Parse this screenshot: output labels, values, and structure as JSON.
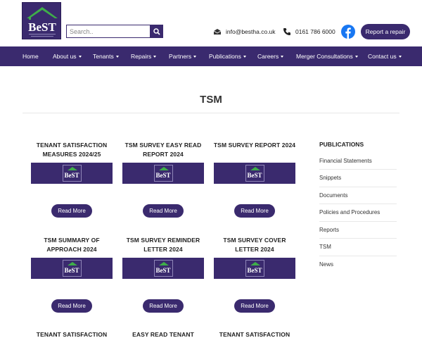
{
  "header": {
    "logo_text": "BeST",
    "search_placeholder": "Search..",
    "email": "info@bestha.co.uk",
    "phone": "0161 786 6000",
    "repair_label": "Report a repair"
  },
  "nav": [
    {
      "label": "Home",
      "dropdown": false
    },
    {
      "label": "About us",
      "dropdown": true
    },
    {
      "label": "Tenants",
      "dropdown": true
    },
    {
      "label": "Repairs",
      "dropdown": true
    },
    {
      "label": "Partners",
      "dropdown": true
    },
    {
      "label": "Publications",
      "dropdown": true
    },
    {
      "label": "Careers",
      "dropdown": true
    },
    {
      "label": "Merger Consultations",
      "dropdown": true
    },
    {
      "label": "Contact us",
      "dropdown": true
    }
  ],
  "page": {
    "title": "TSM"
  },
  "cards": [
    {
      "title": "TENANT SATISFACTION MEASURES 2024/25",
      "logo": "BeST",
      "button": "Read More"
    },
    {
      "title": "TSM SURVEY EASY READ REPORT 2024",
      "logo": "BeST",
      "button": "Read More"
    },
    {
      "title": "TSM SURVEY REPORT 2024",
      "logo": "BeST",
      "button": "Read More"
    },
    {
      "title": "TSM SUMMARY OF APPROACH 2024",
      "logo": "BeST",
      "button": "Read More"
    },
    {
      "title": "TSM SURVEY REMINDER LETTER 2024",
      "logo": "BeST",
      "button": "Read More"
    },
    {
      "title": "TSM SURVEY COVER LETTER 2024",
      "logo": "BeST",
      "button": "Read More"
    },
    {
      "title": "TENANT SATISFACTION",
      "logo": "",
      "button": ""
    },
    {
      "title": "EASY READ TENANT",
      "logo": "",
      "button": ""
    },
    {
      "title": "TENANT SATISFACTION",
      "logo": "",
      "button": ""
    }
  ],
  "sidebar": {
    "title": "PUBLICATIONS",
    "items": [
      "Financial Statements",
      "Snippets",
      "Documents",
      "Policies and Procedures",
      "Reports",
      "TSM",
      "News"
    ]
  },
  "colors": {
    "brand": "#3a2a6e",
    "roof": "#3fae49",
    "facebook": "#1877f2"
  },
  "icons": {
    "email": "email-icon",
    "phone": "phone-icon",
    "search": "search-icon",
    "facebook": "facebook-icon"
  }
}
